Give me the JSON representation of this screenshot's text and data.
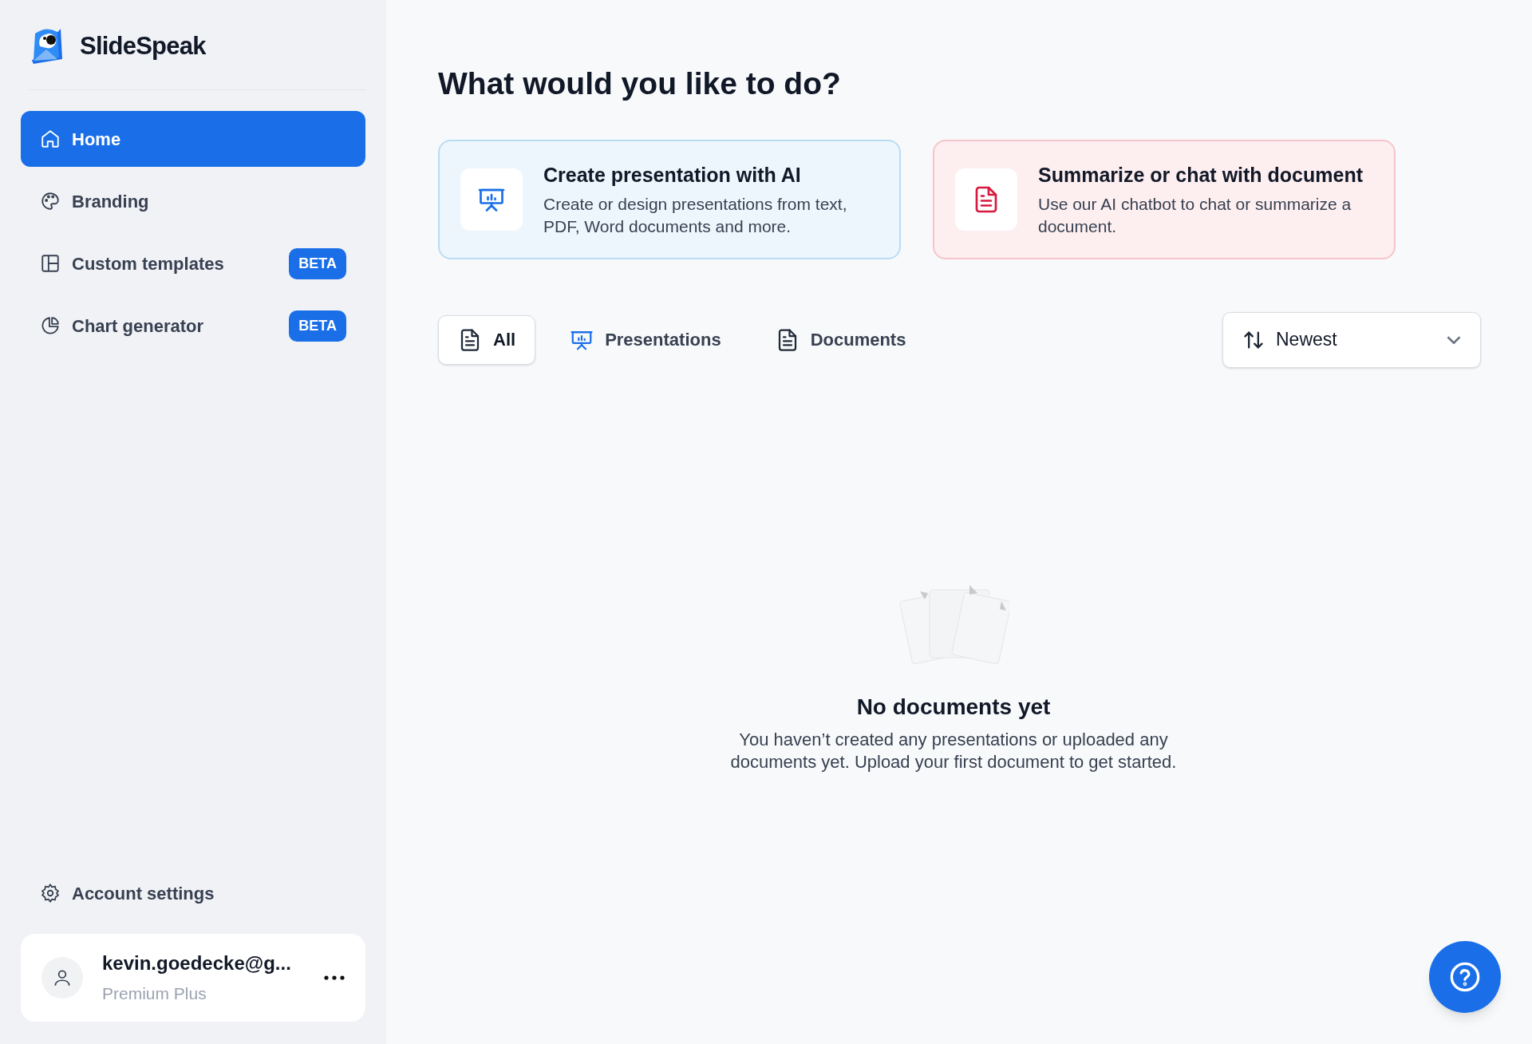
{
  "brand": {
    "name": "SlideSpeak"
  },
  "sidebar": {
    "items": [
      {
        "label": "Home",
        "kind": "home",
        "selected": true
      },
      {
        "label": "Branding",
        "kind": "branding",
        "selected": false
      },
      {
        "label": "Custom templates",
        "kind": "templates",
        "selected": false,
        "badge": "BETA"
      },
      {
        "label": "Chart generator",
        "kind": "charts",
        "selected": false,
        "badge": "BETA"
      }
    ],
    "footer_items": [
      {
        "label": "Account settings",
        "kind": "settings"
      }
    ],
    "user": {
      "email": "kevin.goedecke@g...",
      "plan": "Premium Plus"
    }
  },
  "heading": "What would you like to do?",
  "action_cards": [
    {
      "kind": "presentation",
      "title": "Create presentation with AI",
      "description": "Create or design presentations from text, PDF, Word documents and more."
    },
    {
      "kind": "document",
      "title": "Summarize or chat with document",
      "description": "Use our AI chatbot to chat or summarize a document."
    }
  ],
  "filter_tabs": [
    {
      "label": "All",
      "kind": "document",
      "selected": true
    },
    {
      "label": "Presentations",
      "kind": "presentation",
      "selected": false
    },
    {
      "label": "Documents",
      "kind": "document",
      "selected": false
    }
  ],
  "sort": {
    "value": "Newest"
  },
  "empty_state": {
    "title": "No documents yet",
    "description": "You haven’t created any presentations or uploaded any documents yet. Upload your first document to get started."
  }
}
